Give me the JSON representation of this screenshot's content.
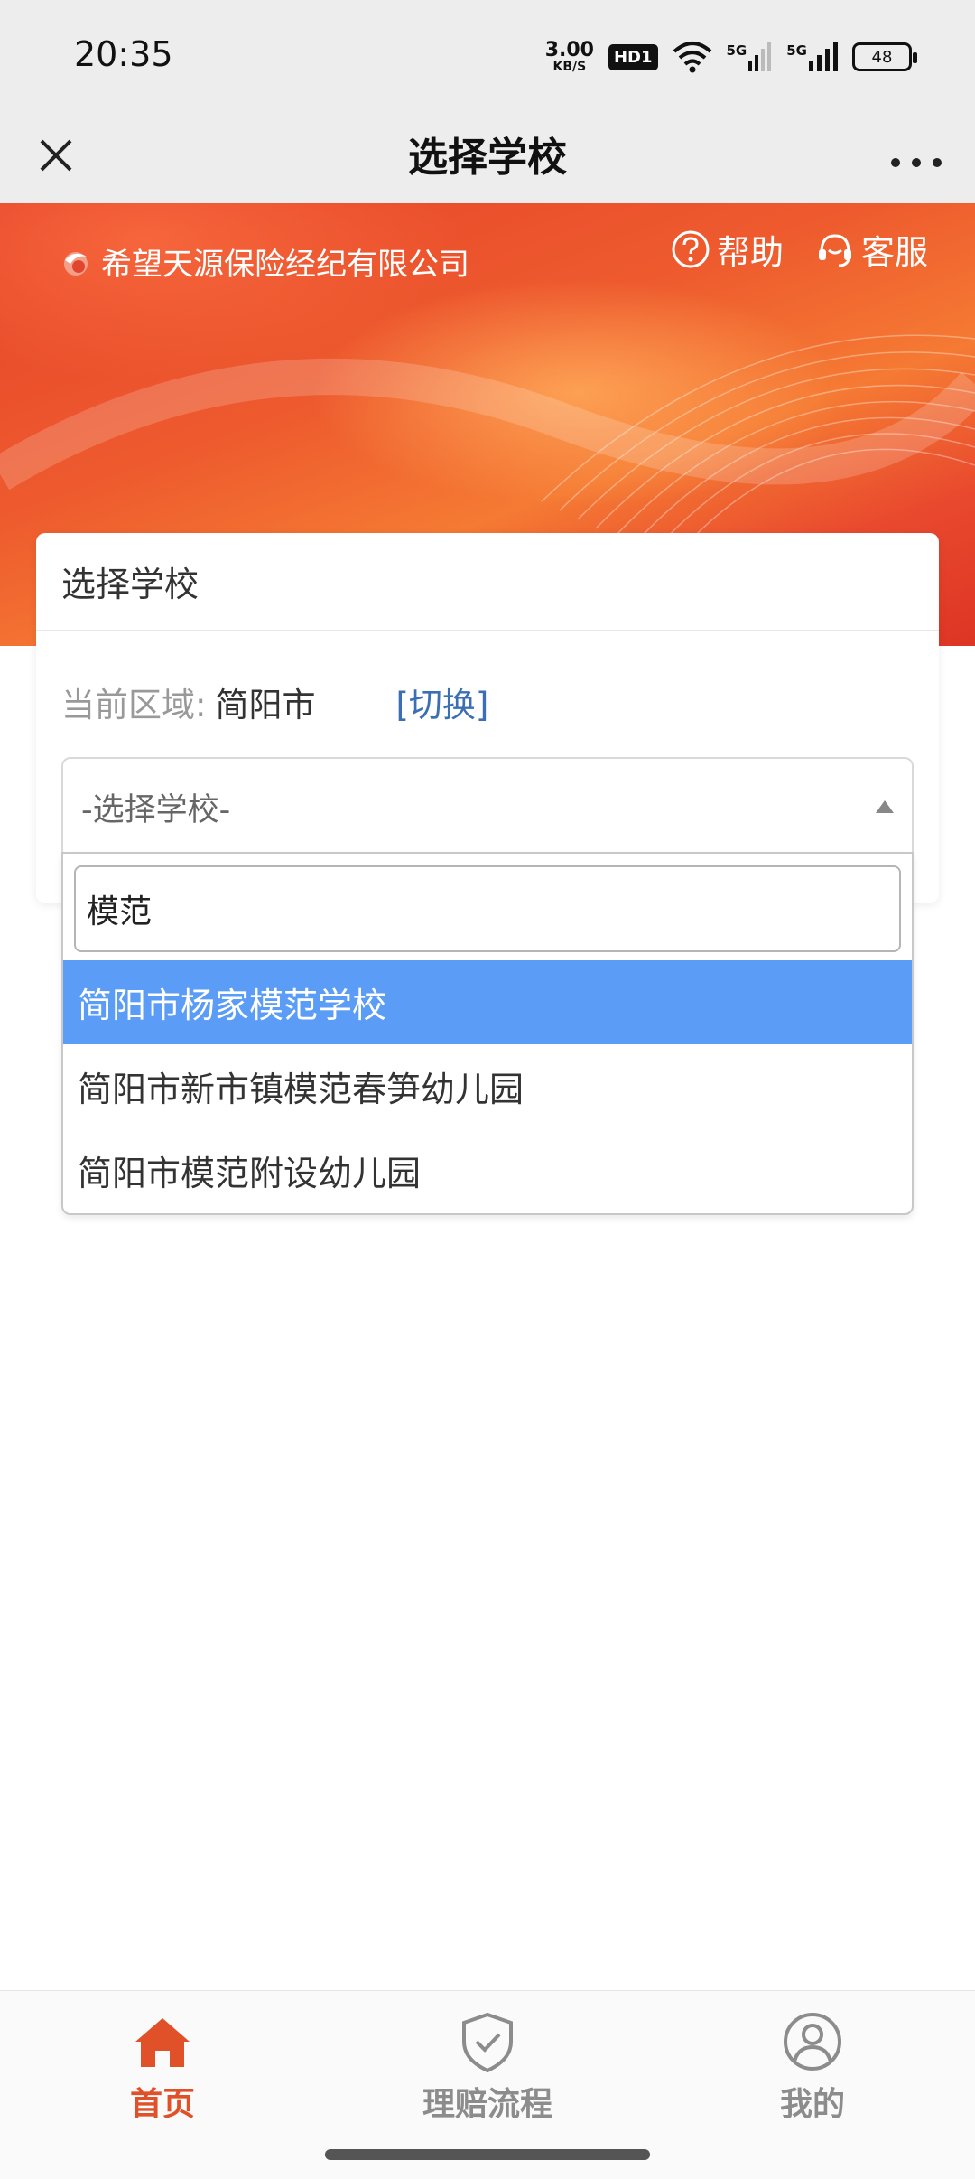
{
  "status_bar": {
    "time": "20:35",
    "net_speed_value": "3.00",
    "net_speed_unit": "KB/S",
    "hd_badge": "HD1",
    "signal1": "5G",
    "signal2": "5G",
    "battery": "48"
  },
  "navbar": {
    "title": "选择学校"
  },
  "banner": {
    "company_name": "希望天源保险经纪有限公司",
    "help_label": "帮助",
    "service_label": "客服"
  },
  "card": {
    "title": "选择学校",
    "region_label": "当前区域:",
    "region_value": "简阳市",
    "switch_label": "[切换]",
    "select_placeholder": "-选择学校-"
  },
  "dropdown": {
    "search_value": "模范",
    "options": [
      {
        "label": "简阳市杨家模范学校",
        "highlighted": true
      },
      {
        "label": "简阳市新市镇模范春笋幼儿园",
        "highlighted": false
      },
      {
        "label": "简阳市模范附设幼儿园",
        "highlighted": false
      }
    ]
  },
  "tabbar": {
    "home": "首页",
    "claims": "理赔流程",
    "mine": "我的"
  },
  "colors": {
    "accent": "#e0512a",
    "highlight": "#5b9cf7",
    "link": "#3b6fb3"
  }
}
